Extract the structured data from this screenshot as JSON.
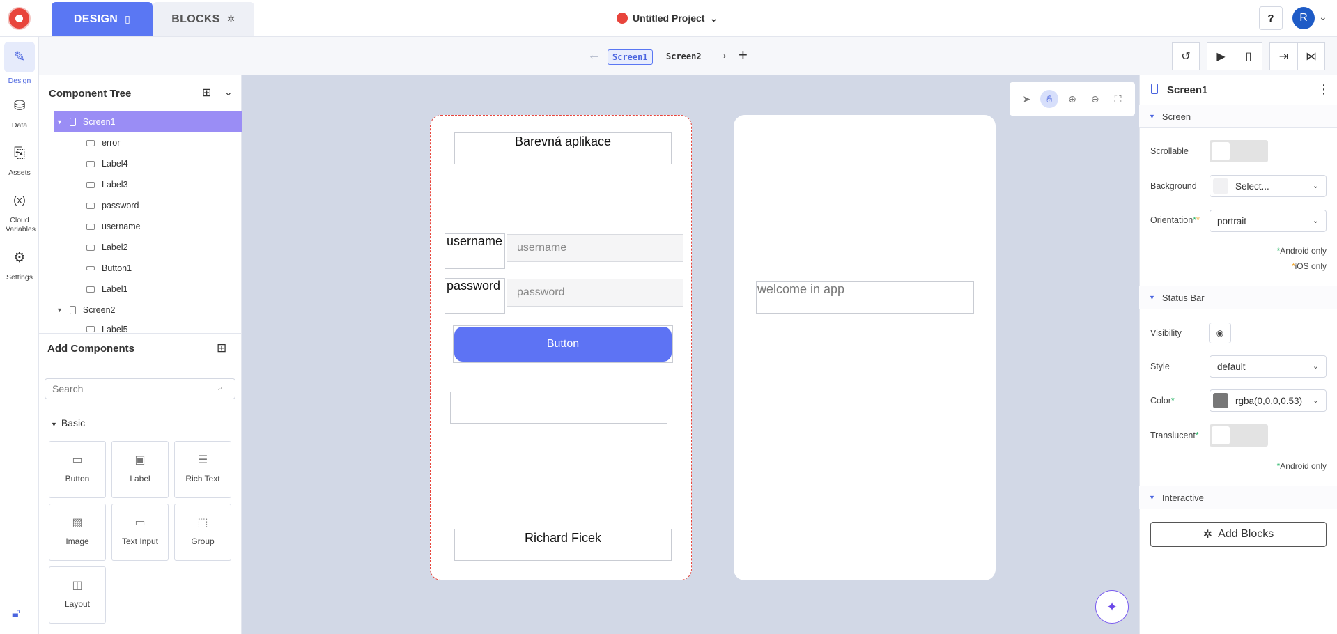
{
  "topbar": {
    "design_tab": "DESIGN",
    "blocks_tab": "BLOCKS",
    "project_name": "Untitled Project",
    "help_label": "?",
    "avatar_initial": "R"
  },
  "rail": {
    "items": [
      {
        "label": "Design",
        "icon": "pencil-icon"
      },
      {
        "label": "Data",
        "icon": "database-icon"
      },
      {
        "label": "Assets",
        "icon": "paperclip-icon"
      },
      {
        "label": "Cloud Variables",
        "icon": "variable-icon"
      },
      {
        "label": "Settings",
        "icon": "gear-icon"
      }
    ]
  },
  "screenbar": {
    "screens": [
      "Screen1",
      "Screen2"
    ],
    "active": "Screen1"
  },
  "tree": {
    "title": "Component Tree",
    "items": [
      {
        "label": "Screen1",
        "level": 0
      },
      {
        "label": "error",
        "level": 1
      },
      {
        "label": "Label4",
        "level": 1
      },
      {
        "label": "Label3",
        "level": 1
      },
      {
        "label": "password",
        "level": 1
      },
      {
        "label": "username",
        "level": 1
      },
      {
        "label": "Label2",
        "level": 1
      },
      {
        "label": "Button1",
        "level": 1
      },
      {
        "label": "Label1",
        "level": 1
      },
      {
        "label": "Screen2",
        "level": 0
      },
      {
        "label": "Label5",
        "level": 1
      }
    ]
  },
  "add_components": {
    "title": "Add Components",
    "search_placeholder": "Search",
    "category": "Basic",
    "components": [
      "Button",
      "Label",
      "Rich Text",
      "Image",
      "Text Input",
      "Group",
      "Layout"
    ]
  },
  "screen1": {
    "title_label": "Barevná aplikace",
    "username_label": "username",
    "username_placeholder": "username",
    "password_label": "password",
    "password_placeholder": "password",
    "button_label": "Button",
    "footer_label": "Richard Ficek"
  },
  "screen2": {
    "welcome_label": "welcome in app"
  },
  "props": {
    "title": "Screen1",
    "section_screen": "Screen",
    "scrollable_label": "Scrollable",
    "background_label": "Background",
    "background_value": "Select...",
    "orientation_label": "Orientation",
    "orientation_value": "portrait",
    "android_only": "Android only",
    "ios_only": "iOS only",
    "section_status": "Status Bar",
    "visibility_label": "Visibility",
    "style_label": "Style",
    "style_value": "default",
    "color_label": "Color",
    "color_value": "rgba(0,0,0,0.53)",
    "translucent_label": "Translucent",
    "android_only_2": "Android only",
    "section_interactive": "Interactive",
    "add_blocks": "Add Blocks"
  },
  "colors": {
    "accent": "#5a77f3",
    "button": "#5d73f4",
    "selection": "#9a8df5",
    "canvas": "#d2d8e6",
    "status_color_swatch": "#777777"
  }
}
